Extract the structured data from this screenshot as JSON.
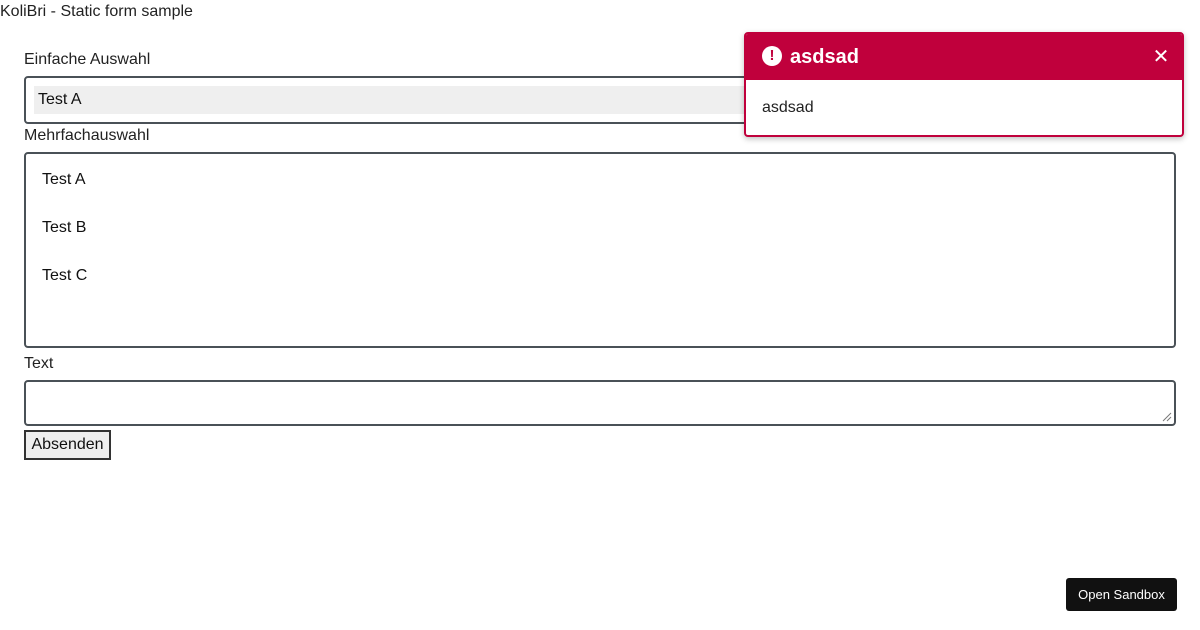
{
  "page": {
    "title": "KoliBri - Static form sample"
  },
  "form": {
    "single_select": {
      "label": "Einfache Auswahl",
      "selected": "Test A"
    },
    "multi_select": {
      "label": "Mehrfachauswahl",
      "options": [
        "Test A",
        "Test B",
        "Test C"
      ]
    },
    "text": {
      "label": "Text",
      "value": ""
    },
    "submit_label": "Absenden"
  },
  "toast": {
    "title": "asdsad",
    "body": "asdsad",
    "icon": "exclamation-circle-icon",
    "close_icon": "close-icon",
    "accent": "#c0003c"
  },
  "sandbox": {
    "label": "Open Sandbox"
  }
}
